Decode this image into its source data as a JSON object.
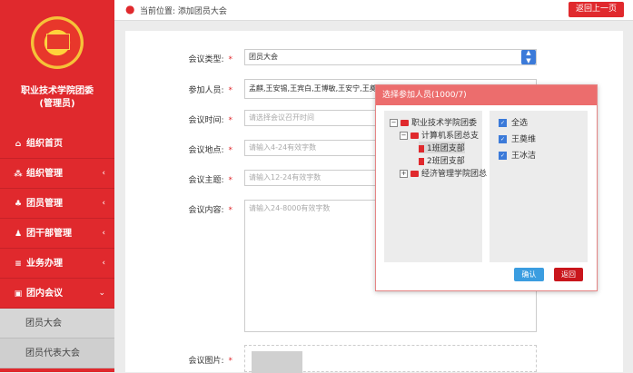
{
  "sidebar": {
    "org_title_line1": "职业技术学院团委",
    "org_title_line2": "(管理员)",
    "items": [
      {
        "label": "组织首页",
        "icon": "home-icon",
        "chevron": ""
      },
      {
        "label": "组织管理",
        "icon": "org-icon",
        "chevron": "‹"
      },
      {
        "label": "团员管理",
        "icon": "members-icon",
        "chevron": "‹"
      },
      {
        "label": "团干部管理",
        "icon": "cadre-icon",
        "chevron": "‹"
      },
      {
        "label": "业务办理",
        "icon": "list-icon",
        "chevron": "‹"
      },
      {
        "label": "团内会议",
        "icon": "meeting-icon",
        "chevron": "⌄"
      }
    ],
    "sub_items": [
      "团员大会",
      "团员代表大会"
    ]
  },
  "topbar": {
    "breadcrumb": "当前位置: 添加团员大会",
    "back_label": "返回上一页"
  },
  "form": {
    "type_label": "会议类型:",
    "type_value": "团员大会",
    "people_label": "参加人员:",
    "people_value": "孟麒,王安锡,王宾白,王博敏,王安宁,王奠维,王",
    "time_label": "会议时间:",
    "time_placeholder": "请选择会议召开时间",
    "place_label": "会议地点:",
    "place_placeholder": "请输入4-24有效字数",
    "topic_label": "会议主题:",
    "topic_placeholder": "请输入12-24有效字数",
    "content_label": "会议内容:",
    "content_placeholder": "请输入24-8000有效字数",
    "image_label": "会议图片:",
    "required_mark": "*"
  },
  "dialog": {
    "title": "选择参加人员(1000/7)",
    "tree": [
      {
        "label": "职业技术学院团委",
        "toggle": "−"
      },
      {
        "label": "计算机系团总支",
        "toggle": "−"
      },
      {
        "label": "1班团支部"
      },
      {
        "label": "2班团支部"
      },
      {
        "label": "经济管理学院团总",
        "toggle": "+"
      }
    ],
    "selected": [
      "全选",
      "王奠维",
      "王冰洁"
    ],
    "ok_label": "确认",
    "cancel_label": "返回"
  },
  "colors": {
    "brand_red": "#e0292d",
    "accent_blue": "#3b7ad9"
  }
}
